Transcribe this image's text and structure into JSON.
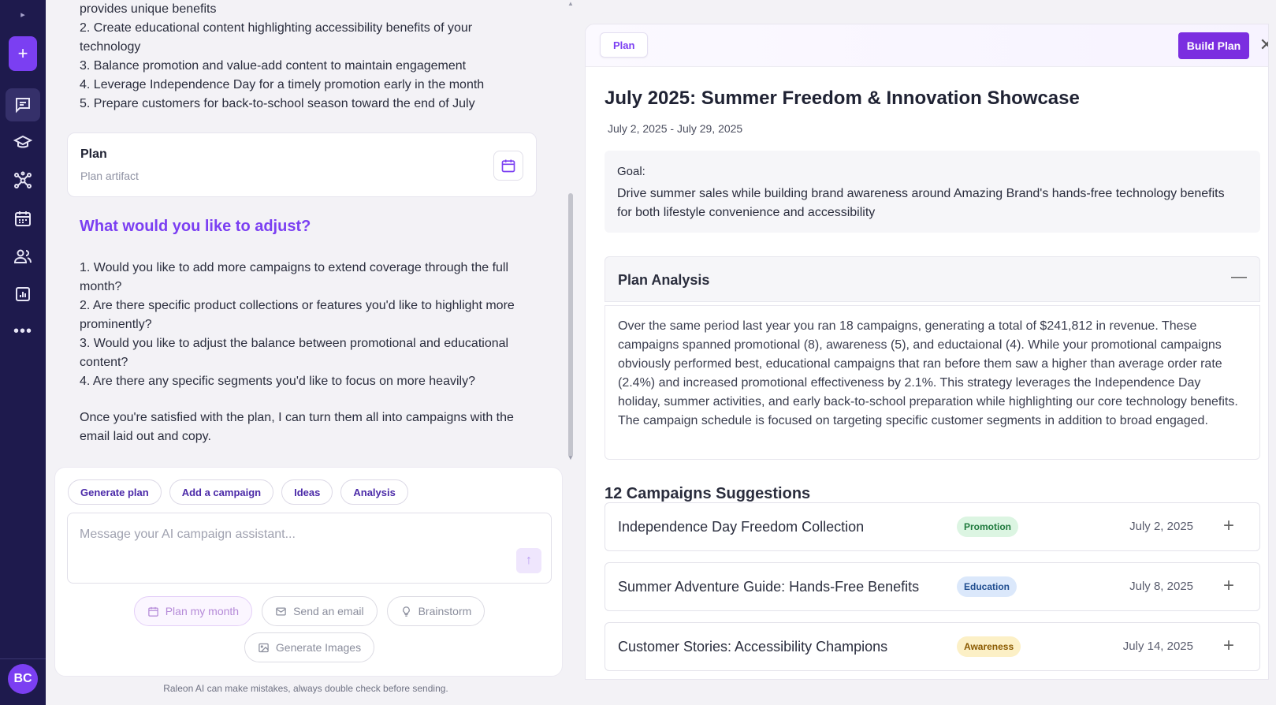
{
  "sidebar": {
    "toggle_icon": "chevron-right-icon",
    "new_label": "+",
    "items": [
      {
        "icon": "chat-icon",
        "active": true
      },
      {
        "icon": "graduation-cap-icon",
        "active": false
      },
      {
        "icon": "network-icon",
        "active": false
      },
      {
        "icon": "calendar-icon",
        "active": false
      },
      {
        "icon": "users-icon",
        "active": false
      },
      {
        "icon": "report-icon",
        "active": false
      }
    ],
    "more_label": "•••",
    "avatar_initials": "BC"
  },
  "chat": {
    "top_list": [
      "provides unique benefits",
      "2. Create educational content highlighting accessibility benefits of your technology",
      "3. Balance promotion and value-add content to maintain engagement",
      "4. Leverage Independence Day for a timely promotion early in the month",
      "5. Prepare customers for back-to-school season toward the end of July"
    ],
    "plan_card": {
      "title": "Plan",
      "subtitle": "Plan artifact"
    },
    "adjust_title": "What would you like to adjust?",
    "adjust_list": [
      "1. Would you like to add more campaigns to extend coverage through the full month?",
      "2. Are there specific product collections or features you'd like to highlight more prominently?",
      "3. Would you like to adjust the balance between promotional and educational content?",
      "4. Are there any specific segments you'd like to focus on more heavily?"
    ],
    "closing": "Once you're satisfied with the plan, I can turn them all into campaigns with the email laid out and copy."
  },
  "composer": {
    "chips": [
      "Generate plan",
      "Add a campaign",
      "Ideas",
      "Analysis"
    ],
    "placeholder": "Message your AI campaign assistant...",
    "actions": {
      "plan_month": "Plan my month",
      "send_email": "Send an email",
      "brainstorm": "Brainstorm",
      "generate_images": "Generate Images"
    },
    "disclaimer": "Raleon AI can make mistakes, always double check before sending."
  },
  "panel": {
    "tab_label": "Plan",
    "build_label": "Build Plan",
    "close_label": "✕",
    "title": "July 2025: Summer Freedom & Innovation Showcase",
    "dates": "July 2, 2025 - July 29, 2025",
    "goal_label": "Goal:",
    "goal_text": "Drive summer sales while building brand awareness around Amazing Brand's hands-free technology benefits for both lifestyle convenience and accessibility",
    "analysis_title": "Plan Analysis",
    "analysis_toggle": "—",
    "analysis_text": "Over the same period last year you ran 18 campaigns, generating a total of $241,812 in revenue. These campaigns spanned promotional (8), awareness (5), and eductaional (4). While your promotional campaigns obviously performed best, educational campaigns that ran before them saw a higher than average order rate (2.4%) and increased promotional effectiveness by 2.1%. This strategy leverages the Independence Day holiday, summer activities, and early back-to-school preparation while highlighting our core technology benefits. The campaign schedule is focused on targeting specific customer segments in addition to broad engaged.",
    "campaigns_title": "12 Campaigns Suggestions",
    "campaigns": [
      {
        "name": "Independence Day Freedom Collection",
        "tag": "Promotion",
        "date": "July 2, 2025"
      },
      {
        "name": "Summer Adventure Guide: Hands-Free Benefits",
        "tag": "Education",
        "date": "July 8, 2025"
      },
      {
        "name": "Customer Stories: Accessibility Champions",
        "tag": "Awareness",
        "date": "July 14, 2025"
      }
    ]
  },
  "colors": {
    "sidebar_bg": "#1e1a4d",
    "accent": "#7b3ff2",
    "build_button": "#7b2ee0"
  }
}
